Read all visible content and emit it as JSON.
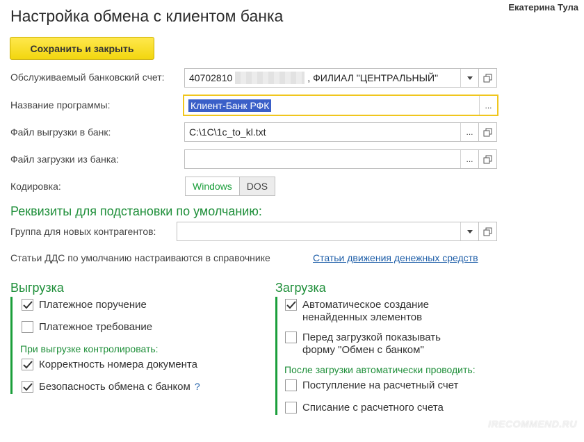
{
  "header": {
    "title": "Настройка обмена с клиентом банка",
    "user": "Екатерина Тула"
  },
  "toolbar": {
    "save_close_label": "Сохранить и закрыть"
  },
  "form": {
    "bank_account_label": "Обслуживаемый банковский счет:",
    "bank_account_prefix": "40702810",
    "bank_account_suffix": ", ФИЛИАЛ \"ЦЕНТРАЛЬНЫЙ\"",
    "program_label": "Название программы:",
    "program_value": "Клиент-Банк РФК",
    "export_file_label": "Файл выгрузки в банк:",
    "export_file_value": "C:\\1C\\1c_to_kl.txt",
    "import_file_label": "Файл загрузки из банка:",
    "import_file_value": "",
    "encoding_label": "Кодировка:",
    "encoding_options": [
      "Windows",
      "DOS"
    ],
    "encoding_selected": "Windows"
  },
  "defaults": {
    "heading": "Реквизиты для подстановки по умолчанию:",
    "group_label": "Группа для новых контрагентов:",
    "group_value": "",
    "dds_note": "Статьи ДДС по умолчанию настраиваются в справочнике",
    "dds_link": "Статьи движения денежных средств"
  },
  "export": {
    "heading": "Выгрузка",
    "items": [
      {
        "label": "Платежное поручение",
        "checked": true
      },
      {
        "label": "Платежное требование",
        "checked": false
      }
    ],
    "control_label": "При выгрузке контролировать:",
    "control_items": [
      {
        "label": "Корректность номера документа",
        "checked": true
      },
      {
        "label": "Безопасность обмена с банком",
        "checked": true
      }
    ],
    "help": "?"
  },
  "import": {
    "heading": "Загрузка",
    "items": [
      {
        "label_line1": "Автоматическое создание",
        "label_line2": "ненайденных элементов",
        "checked": true
      },
      {
        "label_line1": "Перед загрузкой показывать",
        "label_line2": "форму \"Обмен с банком\"",
        "checked": false
      }
    ],
    "post_label": "После загрузки автоматически проводить:",
    "post_items": [
      {
        "label": "Поступление на расчетный счет",
        "checked": false
      },
      {
        "label": "Списание с расчетного счета",
        "checked": false
      }
    ]
  },
  "watermark": "IRECOMMEND.RU",
  "colors": {
    "accent_green": "#1f8f3a",
    "button_yellow": "#f2d60f",
    "link_blue": "#1e5ea8",
    "focus_border": "#f0c61d"
  }
}
